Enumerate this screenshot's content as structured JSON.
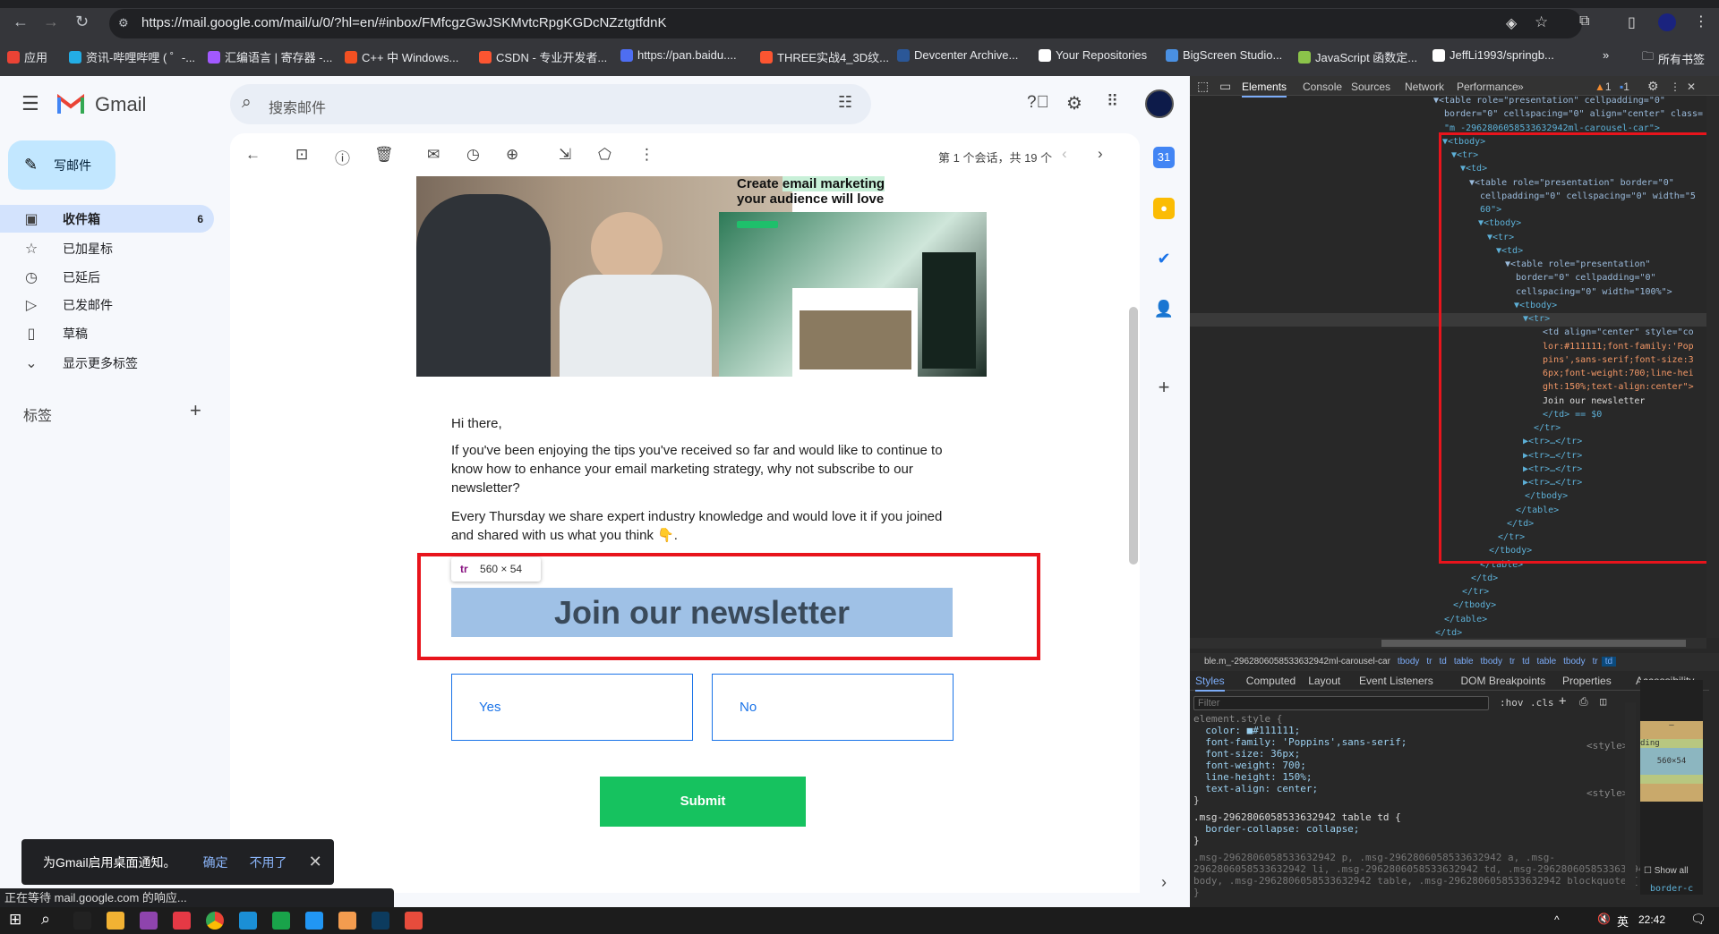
{
  "browser": {
    "url": "https://mail.google.com/mail/u/0/?hl=en/#inbox/FMfcgzGwJSKMvtcRpgKGDcNZztgtfdnK",
    "bookmarks": [
      {
        "label": "应用",
        "color": "#ea4335"
      },
      {
        "label": "资讯-哔哩哔哩 ( ゜-...",
        "color": "#23ade5"
      },
      {
        "label": "汇编语言 | 寄存器 -...",
        "color": "#a259ff"
      },
      {
        "label": "C++ 中 Windows...",
        "color": "#f25022"
      },
      {
        "label": "CSDN - 专业开发者...",
        "color": "#fc5531"
      },
      {
        "label": "https://pan.baidu....",
        "color": "#4e6ef2"
      },
      {
        "label": "THREE实战4_3D纹...",
        "color": "#fc5531"
      },
      {
        "label": "Devcenter Archive...",
        "color": "#2b5797"
      },
      {
        "label": "Your Repositories",
        "color": "#ffffff"
      },
      {
        "label": "BigScreen Studio...",
        "color": "#4a90e2"
      },
      {
        "label": "JavaScript 函数定...",
        "color": "#8bc34a"
      },
      {
        "label": "JeffLi1993/springb...",
        "color": "#ffffff"
      }
    ],
    "all_bookmarks": "所有书签",
    "more": "»"
  },
  "gmail": {
    "brand": "Gmail",
    "search_placeholder": "搜索邮件",
    "compose": "写邮件",
    "nav": [
      {
        "label": "收件箱",
        "icon": "inbox-icon",
        "glyph": "▣",
        "count": "6",
        "active": true
      },
      {
        "label": "已加星标",
        "icon": "star-icon",
        "glyph": "☆"
      },
      {
        "label": "已延后",
        "icon": "clock-icon",
        "glyph": "◷"
      },
      {
        "label": "已发邮件",
        "icon": "send-icon",
        "glyph": "▷"
      },
      {
        "label": "草稿",
        "icon": "draft-icon",
        "glyph": "▯"
      },
      {
        "label": "显示更多标签",
        "icon": "chevron-down-icon",
        "glyph": "⌄"
      }
    ],
    "labels_heading": "标签",
    "add_label": "+",
    "pagination": "第 1 个会话，共 19 个",
    "email": {
      "hero_headline_1": "Create",
      "hero_highlight": "email marketing",
      "hero_headline_2": "your audience will love",
      "greeting": "Hi there,",
      "para1": "If you've been enjoying the tips you've received so far and would like to continue to know how to enhance your email marketing strategy, why not subscribe to our newsletter?",
      "para2": "Every Thursday we share expert industry knowledge and would love it if you joined and shared with us what you think 👇.",
      "newsletter": "Join our newsletter",
      "yes": "Yes",
      "no": "No",
      "submit": "Submit"
    },
    "inspect_tooltip": {
      "tag": "tr",
      "size": "560 × 54"
    },
    "toast": {
      "text": "为Gmail启用桌面通知。",
      "ok": "确定",
      "no": "不用了"
    },
    "status": "正在等待 mail.google.com 的响应..."
  },
  "devtools": {
    "tabs": [
      "Elements",
      "Console",
      "Sources",
      "Network",
      "Performance",
      "»"
    ],
    "warnings": "1",
    "messages": "1",
    "tree": [
      [
        1,
        "▼<table role=\"presentation\" cellpadding=\"0\""
      ],
      [
        1,
        "  border=\"0\" cellspacing=\"0\" align=\"center\" class="
      ],
      [
        1,
        "  \"m_-2962806058533632942ml-carousel-car\">"
      ],
      [
        2,
        "▼<tbody>"
      ],
      [
        3,
        "▼<tr>"
      ],
      [
        4,
        "▼<td>"
      ],
      [
        5,
        "▼<table role=\"presentation\" border=\"0\""
      ],
      [
        5,
        "  cellpadding=\"0\" cellspacing=\"0\" width=\"5"
      ],
      [
        5,
        "  60\">"
      ],
      [
        6,
        "▼<tbody>"
      ],
      [
        7,
        "▼<tr>"
      ],
      [
        8,
        "▼<td>"
      ],
      [
        9,
        "▼<table role=\"presentation\""
      ],
      [
        9,
        "  border=\"0\" cellpadding=\"0\""
      ],
      [
        9,
        "  cellspacing=\"0\" width=\"100%\">"
      ],
      [
        10,
        "▼<tbody>"
      ],
      [
        11,
        "▼<tr>"
      ],
      [
        12,
        "  <td align=\"center\" style=\"co"
      ],
      [
        12,
        "  lor:#111111;font-family:'Pop"
      ],
      [
        12,
        "  pins',sans-serif;font-size:3"
      ],
      [
        12,
        "  6px;font-weight:700;line-hei"
      ],
      [
        12,
        "  ght:150%;text-align:center\">"
      ],
      [
        12,
        "  Join our newsletter"
      ],
      [
        12,
        "  </td> == $0"
      ],
      [
        11,
        "  </tr>"
      ],
      [
        11,
        "▶<tr>…</tr>"
      ],
      [
        11,
        "▶<tr>…</tr>"
      ],
      [
        11,
        "▶<tr>…</tr>"
      ],
      [
        11,
        "▶<tr>…</tr>"
      ],
      [
        10,
        "  </tbody>"
      ],
      [
        9,
        "  </table>"
      ],
      [
        8,
        "  </td>"
      ],
      [
        7,
        "  </tr>"
      ],
      [
        6,
        "  </tbody>"
      ],
      [
        5,
        "  </table>"
      ],
      [
        4,
        "  </td>"
      ],
      [
        3,
        "  </tr>"
      ],
      [
        2,
        "  </tbody>"
      ],
      [
        1,
        "  </table>"
      ],
      [
        0,
        "  </td>"
      ]
    ],
    "breadcrumbs": [
      "ble.m_-2962806058533632942ml-carousel-car",
      "tbody",
      "tr",
      "td",
      "table",
      "tbody",
      "tr",
      "td",
      "table",
      "tbody",
      "tr",
      "td"
    ],
    "style_tabs": [
      "Styles",
      "Computed",
      "Layout",
      "Event Listeners",
      "DOM Breakpoints",
      "Properties",
      "Accessibility"
    ],
    "filter_placeholder": "Filter",
    "hov": ":hov",
    "cls": ".cls",
    "rules": [
      "element.style {",
      "  color: ■#111111;",
      "  font-family: 'Poppins',sans-serif;",
      "  font-size: 36px;",
      "  font-weight: 700;",
      "  line-height: 150%;",
      "  text-align: center;",
      "}"
    ],
    "rule2": [
      ".msg-2962806058533632942 table td {",
      "  border-collapse: collapse;",
      "}"
    ],
    "rule3": [
      ".msg-2962806058533632942 p, .msg-2962806058533632942 a, .msg-",
      "2962806058533632942 li, .msg-2962806058533632942 td, .msg-2962806058533632942",
      "body, .msg-2962806058533632942 table, .msg-2962806058533632942 blockquote {",
      "}"
    ],
    "style_src": "<style>",
    "box_size": "560×54",
    "box_padding": "ding",
    "box_dash": "–",
    "show_all": "Show all",
    "border_prop": "border-c"
  },
  "taskbar": {
    "time": "22:42",
    "ime": "英"
  }
}
